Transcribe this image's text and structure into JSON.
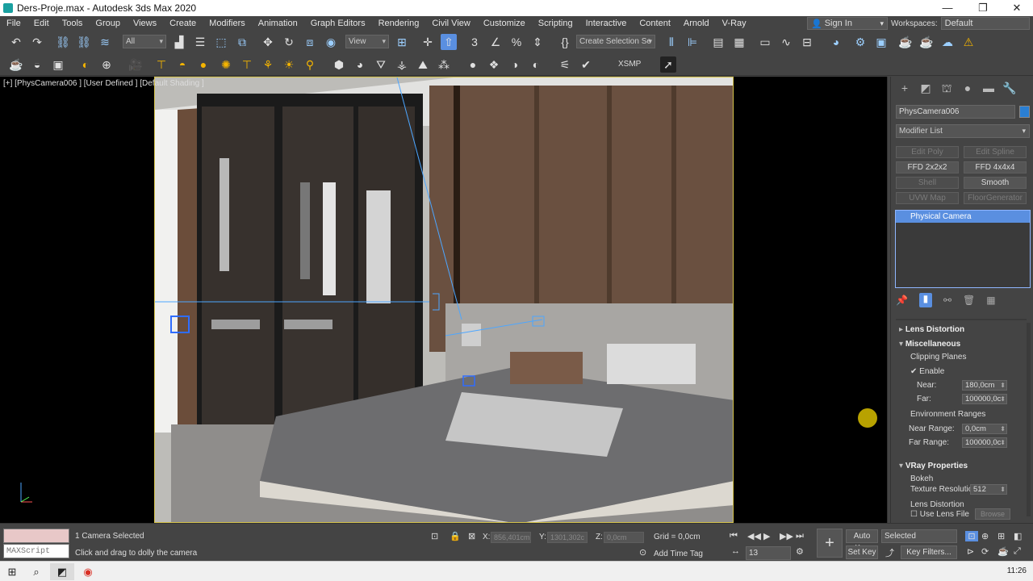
{
  "titlebar": {
    "title": "Ders-Proje.max - Autodesk 3ds Max 2020",
    "min": "—",
    "max": "❐",
    "close": "✕"
  },
  "menu": {
    "items": [
      "File",
      "Edit",
      "Tools",
      "Group",
      "Views",
      "Create",
      "Modifiers",
      "Animation",
      "Graph Editors",
      "Rendering",
      "Civil View",
      "Customize",
      "Scripting",
      "Interactive",
      "Content",
      "Arnold",
      "V-Ray"
    ],
    "sign_in": "Sign In",
    "workspaces_label": "Workspaces:",
    "workspace_value": "Default"
  },
  "toolbar": {
    "selection_filter": "All",
    "reference_coord": "View",
    "named_selection": "Create Selection Se",
    "xsmp_label": "XSMP"
  },
  "viewport": {
    "label": "[+] [PhysCamera006 ] [User Defined ] [Default Shading ]"
  },
  "command_panel": {
    "object_name": "PhysCamera006",
    "object_color": "#2a7fd4",
    "modifier_list": "Modifier List",
    "modifier_buttons": [
      {
        "label": "Edit Poly",
        "enabled": false
      },
      {
        "label": "Edit Spline",
        "enabled": false
      },
      {
        "label": "FFD 2x2x2",
        "enabled": true
      },
      {
        "label": "FFD 4x4x4",
        "enabled": true
      },
      {
        "label": "Shell",
        "enabled": false
      },
      {
        "label": "Smooth",
        "enabled": true
      },
      {
        "label": "UVW Map",
        "enabled": false
      },
      {
        "label": "FloorGenerator",
        "enabled": false
      }
    ],
    "stack_items": [
      "Physical Camera"
    ],
    "rollouts": {
      "lens_distortion": "Lens Distortion",
      "misc": "Miscellaneous",
      "clipping_planes": "Clipping Planes",
      "enable": "Enable",
      "near_label": "Near:",
      "near_value": "180,0cm",
      "far_label": "Far:",
      "far_value": "100000,0c",
      "env_ranges": "Environment Ranges",
      "near_range_label": "Near Range:",
      "near_range_value": "0,0cm",
      "far_range_label": "Far Range:",
      "far_range_value": "100000,0c",
      "vray_props": "VRay Properties",
      "bokeh": "Bokeh",
      "tex_res_label": "Texture Resolutio",
      "tex_res_value": "512",
      "lens_dist2": "Lens Distortion",
      "use_lens_file": "Use Lens File",
      "browse": "Browse"
    }
  },
  "status": {
    "maxscript": "MAXScript Mi:",
    "selected_count": "1 Camera Selected",
    "prompt": "Click and drag to dolly the camera",
    "x_label": "X:",
    "x_value": "856,401cm",
    "y_label": "Y:",
    "y_value": "1301,302c",
    "z_label": "Z:",
    "z_value": "0,0cm",
    "grid": "Grid = 0,0cm",
    "add_time_tag": "Add Time Tag",
    "auto_key": "Auto Key",
    "set_key": "Set Key",
    "selected_dropdown": "Selected",
    "key_filters": "Key Filters...",
    "frame": "13"
  },
  "taskbar": {
    "clock": "11:26"
  }
}
